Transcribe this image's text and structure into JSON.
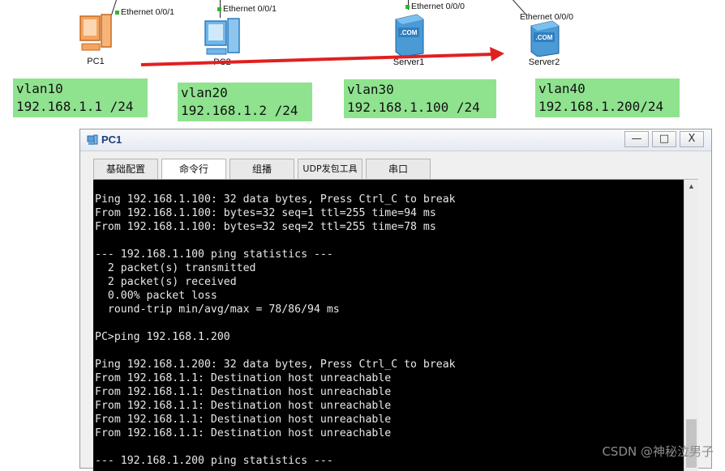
{
  "topology": {
    "devices": [
      {
        "id": "pc1",
        "name": "PC1",
        "port": "Ethernet 0/0/1"
      },
      {
        "id": "pc2",
        "name": "PC2",
        "port": "Ethernet 0/0/1"
      },
      {
        "id": "server1",
        "name": "Server1",
        "port": "Ethernet 0/0/0"
      },
      {
        "id": "server2",
        "name": "Server2",
        "port": "Ethernet 0/0/0"
      }
    ],
    "vlans": [
      {
        "vlan": "vlan10",
        "ip": "192.168.1.1 /24"
      },
      {
        "vlan": "vlan20",
        "ip": "192.168.1.2 /24"
      },
      {
        "vlan": "vlan30",
        "ip": "192.168.1.100 /24"
      },
      {
        "vlan": "vlan40",
        "ip": "192.168.1.200/24"
      }
    ],
    "server_badge": ".COM",
    "arrow_color": "#e02020",
    "vlan_box_color": "#8fe38f"
  },
  "window": {
    "title": "PC1",
    "tabs": [
      "基础配置",
      "命令行",
      "组播",
      "UDP发包工具",
      "串口"
    ],
    "active_tab": "命令行",
    "buttons": {
      "minimize": "—",
      "maximize": "□",
      "close": "X"
    }
  },
  "console": {
    "lines": [
      "Ping 192.168.1.100: 32 data bytes, Press Ctrl_C to break",
      "From 192.168.1.100: bytes=32 seq=1 ttl=255 time=94 ms",
      "From 192.168.1.100: bytes=32 seq=2 ttl=255 time=78 ms",
      "",
      "--- 192.168.1.100 ping statistics ---",
      "  2 packet(s) transmitted",
      "  2 packet(s) received",
      "  0.00% packet loss",
      "  round-trip min/avg/max = 78/86/94 ms",
      "",
      "PC>ping 192.168.1.200",
      "",
      "Ping 192.168.1.200: 32 data bytes, Press Ctrl_C to break",
      "From 192.168.1.1: Destination host unreachable",
      "From 192.168.1.1: Destination host unreachable",
      "From 192.168.1.1: Destination host unreachable",
      "From 192.168.1.1: Destination host unreachable",
      "From 192.168.1.1: Destination host unreachable",
      "",
      "--- 192.168.1.200 ping statistics ---"
    ]
  },
  "watermark": "CSDN @神秘泣男子"
}
